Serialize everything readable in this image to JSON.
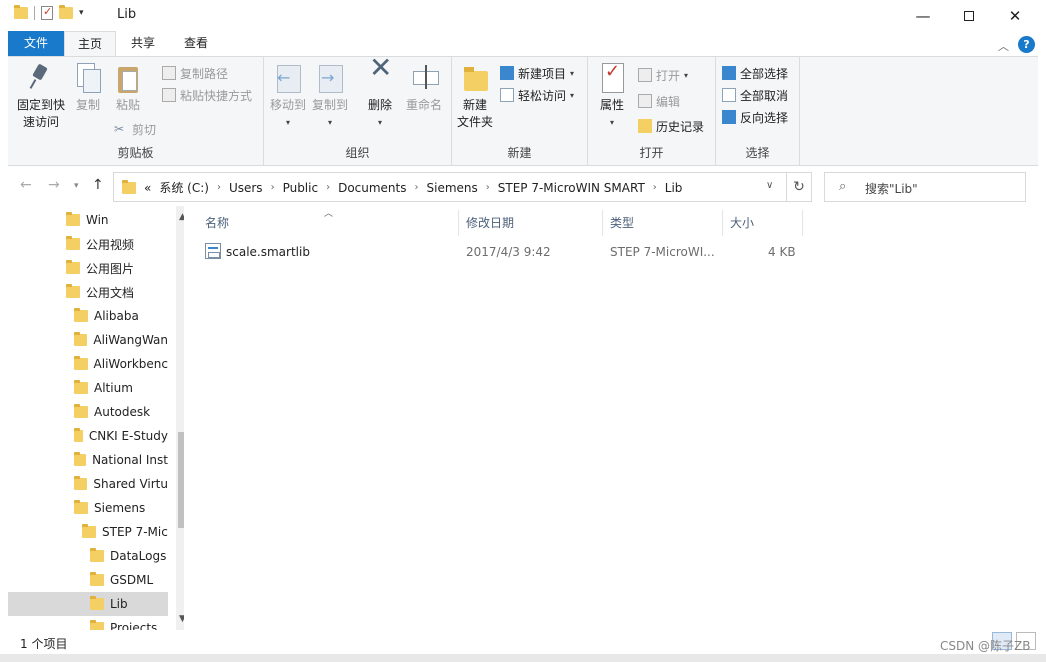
{
  "window": {
    "title": "Lib",
    "controls": {
      "minimize": "—",
      "close": "✕"
    }
  },
  "ribbon_tabs": [
    "文件",
    "主页",
    "共享",
    "查看"
  ],
  "ribbon": {
    "clipboard": {
      "label": "剪贴板",
      "pin": [
        "固定到快",
        "速访问"
      ],
      "copy": "复制",
      "paste": "粘贴",
      "copy_path": "复制路径",
      "paste_shortcut": "粘贴快捷方式",
      "cut": "剪切"
    },
    "organize": {
      "label": "组织",
      "move_to": "移动到",
      "copy_to": "复制到",
      "delete": "删除",
      "rename": "重命名"
    },
    "new": {
      "label": "新建",
      "new_folder": [
        "新建",
        "文件夹"
      ],
      "new_item": "新建项目",
      "easy_access": "轻松访问"
    },
    "open": {
      "label": "打开",
      "properties": "属性",
      "open": "打开",
      "edit": "编辑",
      "history": "历史记录"
    },
    "select": {
      "label": "选择",
      "select_all": "全部选择",
      "select_none": "全部取消",
      "invert": "反向选择"
    }
  },
  "address": {
    "overflow": "«",
    "crumbs": [
      "系统 (C:)",
      "Users",
      "Public",
      "Documents",
      "Siemens",
      "STEP 7-MicroWIN SMART",
      "Lib"
    ]
  },
  "search": {
    "placeholder": "搜索\"Lib\""
  },
  "nav_tree": [
    {
      "label": "Win",
      "selected": false
    },
    {
      "label": "公用视频",
      "selected": false
    },
    {
      "label": "公用图片",
      "selected": false
    },
    {
      "label": "公用文档",
      "selected": false
    },
    {
      "label": "Alibaba",
      "selected": false
    },
    {
      "label": "AliWangWan",
      "selected": false
    },
    {
      "label": "AliWorkbenc",
      "selected": false
    },
    {
      "label": "Altium",
      "selected": false
    },
    {
      "label": "Autodesk",
      "selected": false
    },
    {
      "label": "CNKI E-Study",
      "selected": false
    },
    {
      "label": "National Inst",
      "selected": false
    },
    {
      "label": "Shared Virtu",
      "selected": false
    },
    {
      "label": "Siemens",
      "selected": false
    },
    {
      "label": "STEP 7-Mic",
      "selected": false
    },
    {
      "label": "DataLogs",
      "selected": false
    },
    {
      "label": "GSDML",
      "selected": false
    },
    {
      "label": "Lib",
      "selected": true
    },
    {
      "label": "Projects",
      "selected": false
    }
  ],
  "columns": [
    "名称",
    "修改日期",
    "类型",
    "大小"
  ],
  "files": [
    {
      "name": "scale.smartlib",
      "modified": "2017/4/3 9:42",
      "type": "STEP 7-MicroWI...",
      "size": "4 KB"
    }
  ],
  "status": {
    "item_count": "1 个项目"
  },
  "watermark": "CSDN @陈子ZB"
}
